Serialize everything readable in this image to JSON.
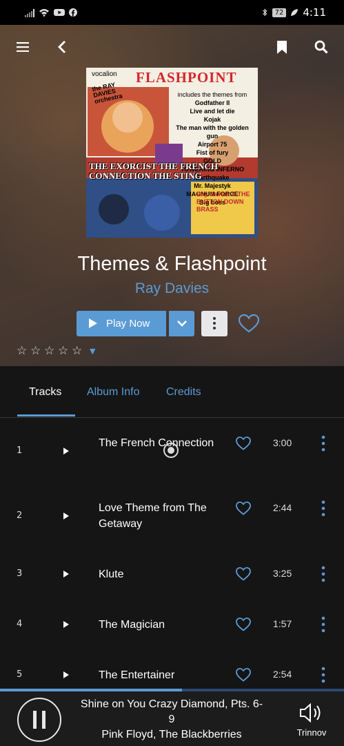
{
  "status_bar": {
    "battery": "72",
    "time": "4:11"
  },
  "album": {
    "title": "Themes & Flashpoint",
    "artist": "Ray Davies",
    "cover": {
      "label": "vocalion",
      "name": "FLASHPOINT",
      "artist_line": "the RAY DAVIES orchestra",
      "themes_intro": "includes the themes from",
      "themes": [
        "Godfather II",
        "Live and let die",
        "Kojak",
        "The man with the golden gun",
        "Airport 75",
        "Fist of fury",
        "GOLD",
        "TOWERING INFERNO",
        "Earthquake",
        "Mr. Majestyk",
        "MAGNUM FORCE",
        "Big boss"
      ],
      "big_text": "THE EXORCIST THE FRENCH CONNECTION THE STING",
      "band": "Ray Davies & THE BUTTON DOWN BRASS"
    }
  },
  "actions": {
    "play_now": "Play Now"
  },
  "rating": {
    "stars": 0,
    "max": 5
  },
  "tabs": [
    {
      "label": "Tracks",
      "active": true
    },
    {
      "label": "Album Info",
      "active": false
    },
    {
      "label": "Credits",
      "active": false
    }
  ],
  "tracks": [
    {
      "number": "1",
      "title": "The French Connection",
      "duration": "3:00",
      "now_playing": true
    },
    {
      "number": "2",
      "title": "Love Theme from The Getaway",
      "duration": "2:44",
      "now_playing": false
    },
    {
      "number": "3",
      "title": "Klute",
      "duration": "3:25",
      "now_playing": false
    },
    {
      "number": "4",
      "title": "The Magician",
      "duration": "1:57",
      "now_playing": false
    },
    {
      "number": "5",
      "title": "The Entertainer",
      "duration": "2:54",
      "now_playing": false
    }
  ],
  "player": {
    "track": "Shine on You Crazy Diamond, Pts. 6-9",
    "artist": "Pink Floyd, The Blackberries",
    "zone": "Trinnov",
    "progress": 0.53
  },
  "colors": {
    "accent": "#5b9bd5",
    "background": "#151515",
    "player_bg": "#1c1c1c"
  }
}
